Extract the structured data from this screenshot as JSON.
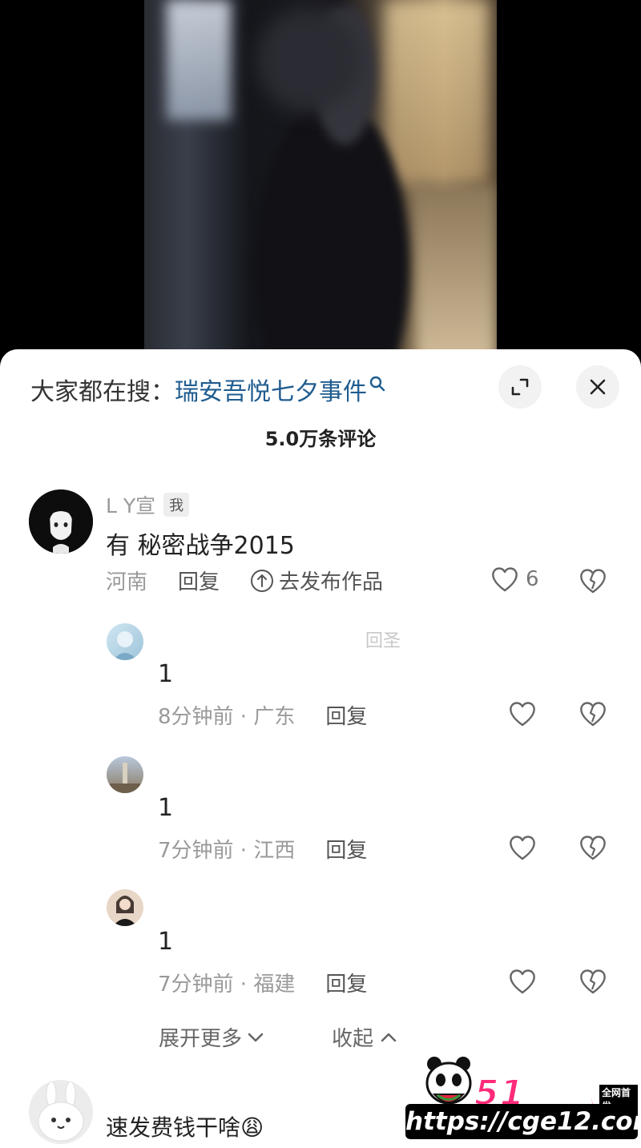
{
  "search": {
    "label": "大家都在搜：",
    "term": "瑞安吾悦七夕事件"
  },
  "comments_header": {
    "count_text": "5.0万条评论"
  },
  "main_comment": {
    "author": "L Y宣",
    "badge": "我",
    "text": "有 秘密战争2015",
    "location": "河南",
    "reply_label": "回复",
    "publish_label": "去发布作品",
    "likes": "6"
  },
  "replies": [
    {
      "name": "回圣",
      "text": "1",
      "meta": "8分钟前 · 广东",
      "reply_label": "回复"
    },
    {
      "name": "",
      "text": "1",
      "meta": "7分钟前 · 江西",
      "reply_label": "回复"
    },
    {
      "name": "",
      "text": "1",
      "meta": "7分钟前 · 福建",
      "reply_label": "回复"
    }
  ],
  "thread_controls": {
    "expand_more": "展开更多",
    "collapse": "收起"
  },
  "next_comment": {
    "text": "速发费钱干啥😩"
  },
  "watermark": {
    "logo": "51吃瓜",
    "tag": "全网首发",
    "url": "https://cge12.com"
  },
  "colors": {
    "search_term": "#1f5c8f",
    "watermark_pink": "#ff2a7a"
  }
}
